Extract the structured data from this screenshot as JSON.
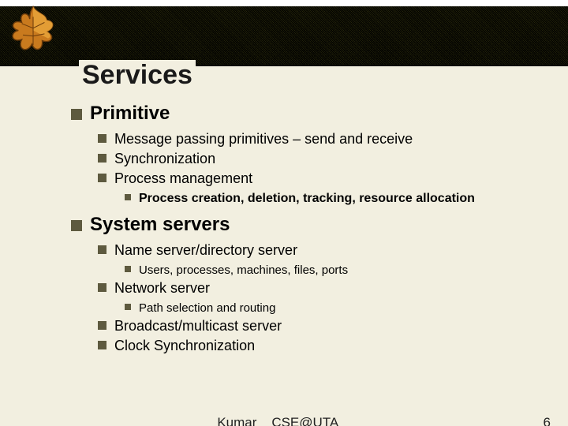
{
  "title": "Services",
  "lvl1": [
    {
      "text": "Primitive",
      "lvl2": [
        {
          "text": "Message passing primitives – send and receive"
        },
        {
          "text": "Synchronization"
        },
        {
          "text": "Process management",
          "lvl3": [
            {
              "text": "Process creation, deletion, tracking, resource allocation"
            }
          ]
        }
      ]
    },
    {
      "text": "System servers",
      "lvl2": [
        {
          "text": "Name server/directory server",
          "lvl3": [
            {
              "text": "Users, processes, machines, files, ports"
            }
          ]
        },
        {
          "text": "Network server",
          "lvl3": [
            {
              "text": "Path selection and routing"
            }
          ]
        },
        {
          "text": "Broadcast/multicast server"
        },
        {
          "text": "Clock Synchronization"
        }
      ]
    }
  ],
  "footer": {
    "author": "Kumar",
    "affiliation": "CSE@UTA",
    "page": "6"
  }
}
